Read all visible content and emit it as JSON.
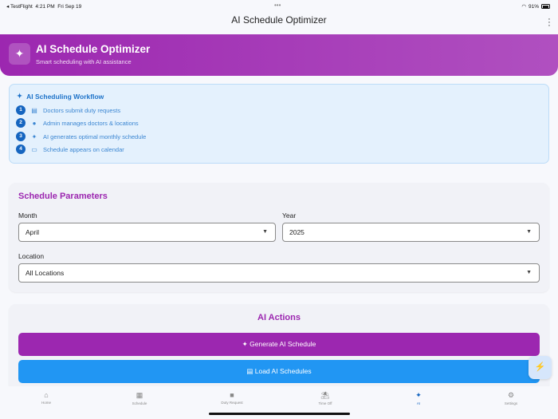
{
  "status": {
    "back_app": "◂ TestFlight",
    "time": "4:21 PM",
    "date": "Fri Sep 19",
    "battery": "91%"
  },
  "nav": {
    "title": "AI Schedule Optimizer"
  },
  "banner": {
    "title": "AI Schedule Optimizer",
    "subtitle": "Smart scheduling with AI assistance"
  },
  "workflow": {
    "title": "AI Scheduling Workflow",
    "steps": [
      {
        "n": "1",
        "icon": "document-icon",
        "text": "Doctors submit duty requests"
      },
      {
        "n": "2",
        "icon": "admin-icon",
        "text": "Admin manages doctors & locations"
      },
      {
        "n": "3",
        "icon": "sparkle-icon",
        "text": "AI generates optimal monthly schedule"
      },
      {
        "n": "4",
        "icon": "calendar-icon",
        "text": "Schedule appears on calendar"
      }
    ]
  },
  "params": {
    "title": "Schedule Parameters",
    "month_label": "Month",
    "month_value": "April",
    "year_label": "Year",
    "year_value": "2025",
    "location_label": "Location",
    "location_value": "All Locations"
  },
  "actions": {
    "title": "AI Actions",
    "generate": "Generate AI Schedule",
    "load": "Load AI Schedules"
  },
  "tabs": [
    {
      "label": "Home"
    },
    {
      "label": "Schedule"
    },
    {
      "label": "Duty Request"
    },
    {
      "label": "Time Off"
    },
    {
      "label": "AI"
    },
    {
      "label": "Settings"
    }
  ],
  "colors": {
    "primary": "#9c27b0",
    "blue": "#2196f3",
    "step": "#1565c0"
  }
}
